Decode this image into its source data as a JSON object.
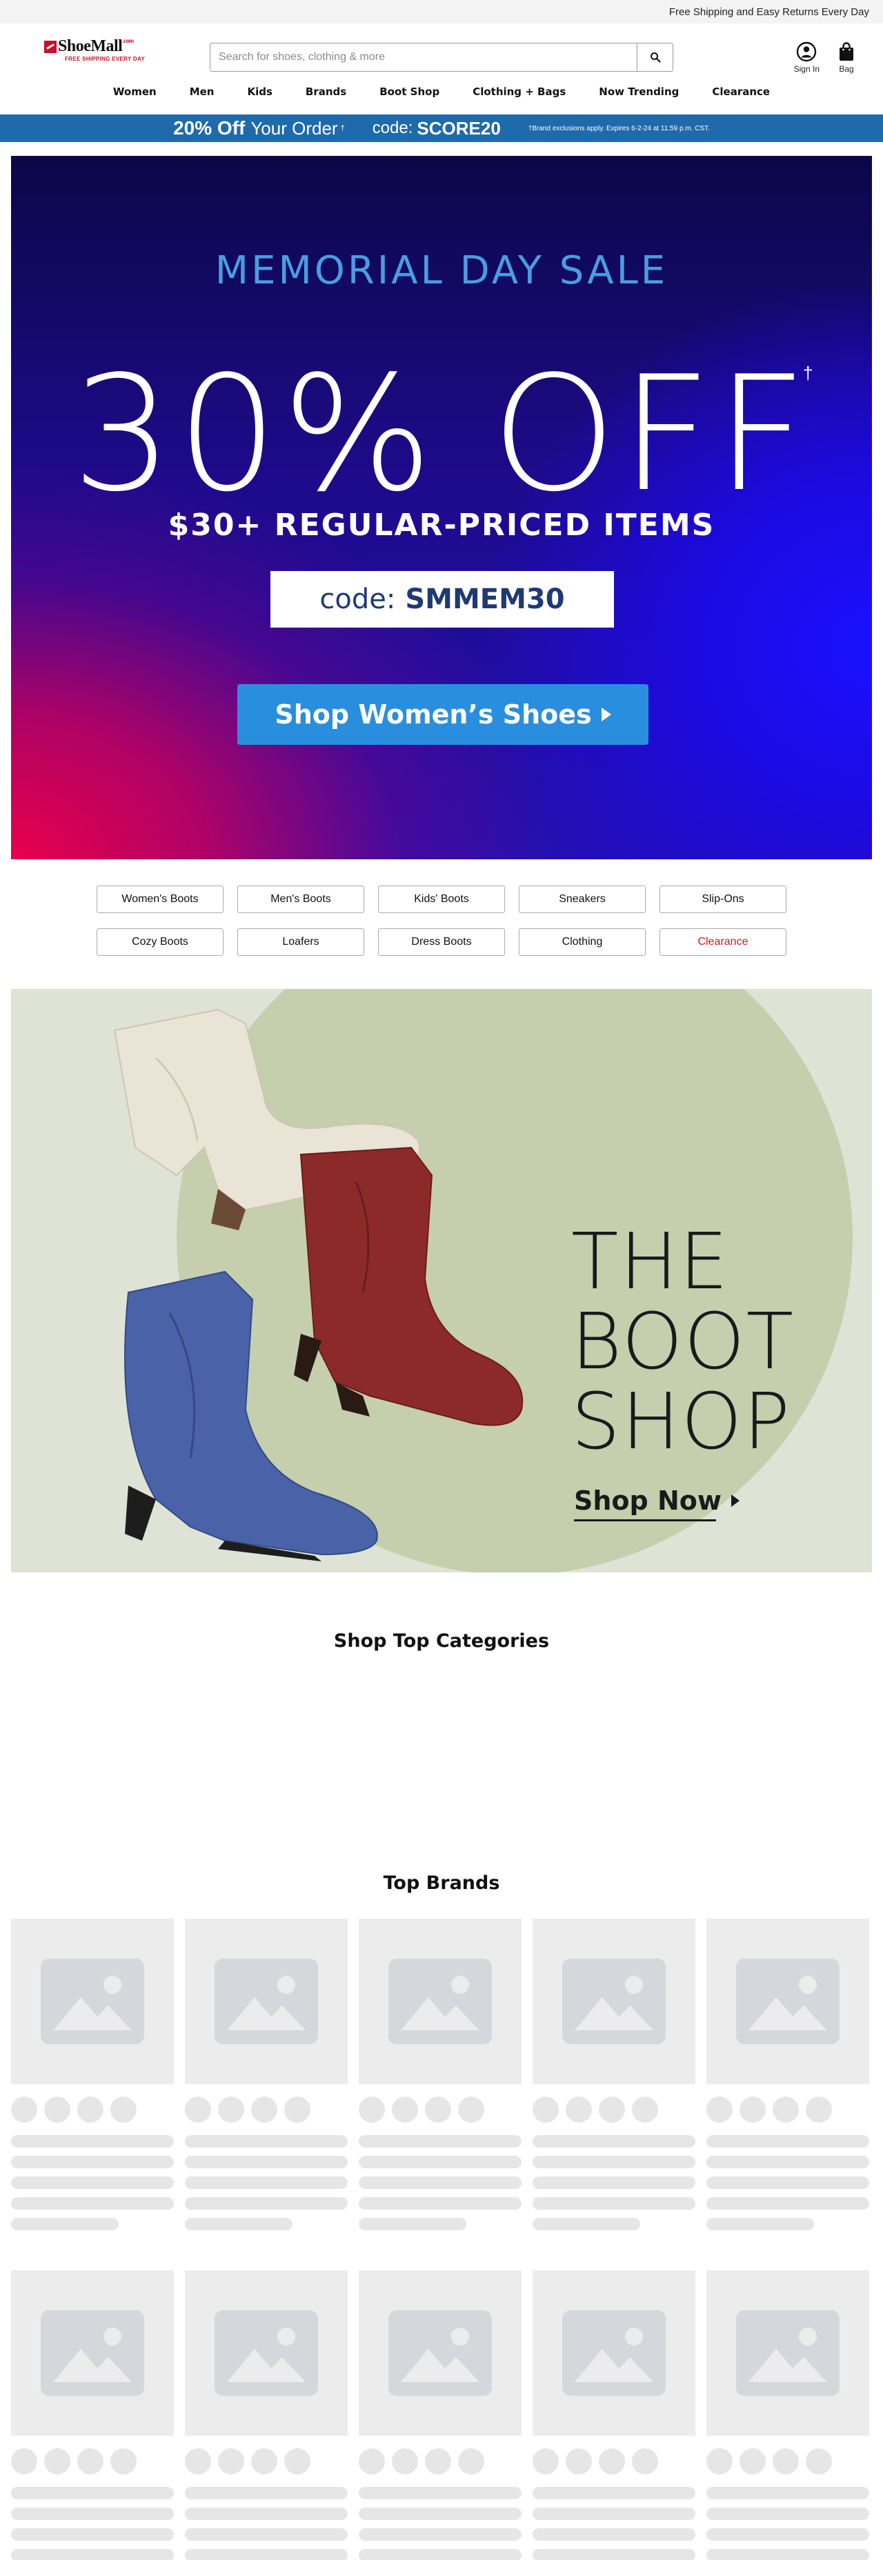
{
  "top_strip": {
    "text": "Free Shipping and Easy Returns Every Day"
  },
  "header": {
    "logo_text": "ShoeMall",
    "logo_com": ".com",
    "logo_tagline": "FREE SHIPPING EVERY DAY",
    "search_placeholder": "Search for shoes, clothing & more",
    "sign_in_label": "Sign In",
    "bag_label": "Bag"
  },
  "nav": {
    "items": [
      "Women",
      "Men",
      "Kids",
      "Brands",
      "Boot Shop",
      "Clothing + Bags",
      "Now Trending",
      "Clearance"
    ]
  },
  "promo_bar": {
    "discount": "20% Off",
    "order_text": "Your Order",
    "dagger": "†",
    "code_label": "code:",
    "code": "SCORE20",
    "fine_print": "†Brand exclusions apply. Expires 6-2-24 at 11:59 p.m. CST."
  },
  "hero": {
    "title": "MEMORIAL DAY SALE",
    "big": "30% OFF",
    "dagger": "†",
    "subtitle": "$30+ REGULAR-PRICED ITEMS",
    "code_label": "code:",
    "code": "SMMEM30",
    "cta": "Shop Women’s Shoes"
  },
  "categories": [
    {
      "label": "Women's Boots",
      "color": "#111111"
    },
    {
      "label": "Men's Boots",
      "color": "#111111"
    },
    {
      "label": "Kids' Boots",
      "color": "#111111"
    },
    {
      "label": "Sneakers",
      "color": "#111111"
    },
    {
      "label": "Slip-Ons",
      "color": "#111111"
    },
    {
      "label": "Cozy Boots",
      "color": "#111111"
    },
    {
      "label": "Loafers",
      "color": "#111111"
    },
    {
      "label": "Dress Boots",
      "color": "#111111"
    },
    {
      "label": "Clothing",
      "color": "#111111"
    },
    {
      "label": "Clearance",
      "color": "#d9141b"
    }
  ],
  "boot_shop": {
    "title_lines": [
      "THE",
      "BOOT",
      "SHOP"
    ],
    "cta": "Shop Now"
  },
  "sections": {
    "top_categories_title": "Shop Top Categories",
    "top_brands_title": "Top Brands"
  },
  "colors": {
    "promo_blue": "#1f6aab",
    "clearance_red": "#d9141b",
    "hero_cta_blue": "#2a8ede"
  }
}
